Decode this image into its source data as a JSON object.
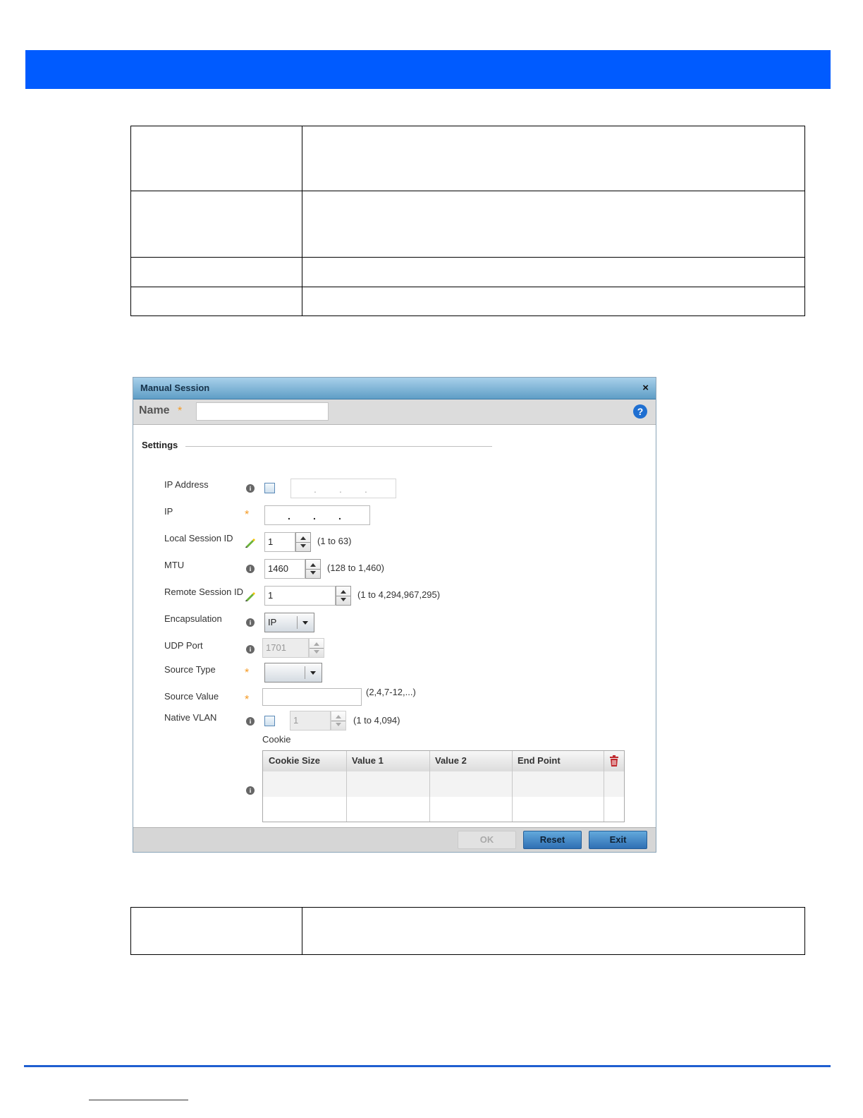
{
  "dialog": {
    "title": "Manual Session",
    "close_glyph": "×",
    "name_label": "Name",
    "required_glyph": "*",
    "help_glyph": "?",
    "section_label": "Settings",
    "fields": {
      "ip_address_label": "IP Address",
      "ip_label": "IP",
      "local_session_id_label": "Local Session ID",
      "local_session_id_value": "1",
      "local_session_id_range": "(1 to 63)",
      "mtu_label": "MTU",
      "mtu_value": "1460",
      "mtu_range": "(128 to 1,460)",
      "remote_session_id_label": "Remote Session ID",
      "remote_session_id_value": "1",
      "remote_session_id_range": "(1 to 4,294,967,295)",
      "encapsulation_label": "Encapsulation",
      "encapsulation_value": "IP",
      "udp_port_label": "UDP Port",
      "udp_port_value": "1701",
      "source_type_label": "Source Type",
      "source_value_label": "Source Value",
      "source_value_hint": "(2,4,7-12,...)",
      "native_vlan_label": "Native VLAN",
      "native_vlan_value": "1",
      "native_vlan_range": "(1 to 4,094)"
    },
    "cookie": {
      "label": "Cookie",
      "columns": [
        "Cookie Size",
        "Value 1",
        "Value 2",
        "End Point"
      ]
    },
    "buttons": {
      "ok": "OK",
      "reset": "Reset",
      "exit": "Exit"
    },
    "icons": {
      "info": "info-icon",
      "required": "required-star-icon",
      "override": "pencil-override-icon",
      "delete": "trash-icon"
    },
    "colors": {
      "banner": "#005bff",
      "title_bar": "#5f9ec6",
      "required_star": "#f59a23",
      "help": "#1f6fd1",
      "trash": "#c0282d"
    }
  }
}
